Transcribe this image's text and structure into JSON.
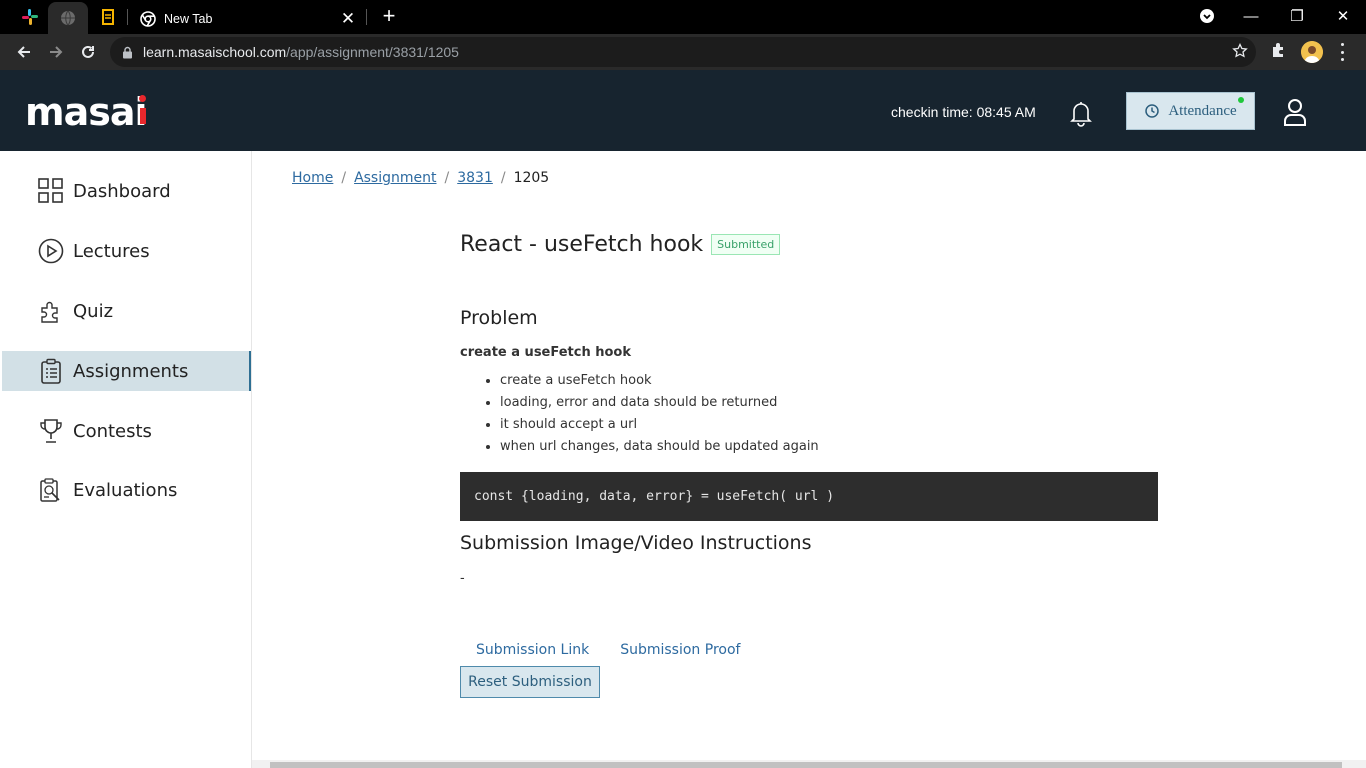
{
  "browser": {
    "tabs": [
      {
        "title": "New Tab"
      }
    ],
    "url_host": "learn.masaischool.com",
    "url_path": "/app/assignment/3831/1205",
    "window_controls": {
      "minimize": "—",
      "maximize": "❐",
      "close": "✕"
    }
  },
  "header": {
    "logo": "masai",
    "checkin": "checkin time: 08:45 AM",
    "attendance_label": "Attendance"
  },
  "sidebar": {
    "items": [
      {
        "label": "Dashboard",
        "icon": "grid-icon"
      },
      {
        "label": "Lectures",
        "icon": "play-circle-icon"
      },
      {
        "label": "Quiz",
        "icon": "puzzle-icon"
      },
      {
        "label": "Assignments",
        "icon": "clipboard-icon",
        "active": true
      },
      {
        "label": "Contests",
        "icon": "trophy-icon"
      },
      {
        "label": "Evaluations",
        "icon": "evaluation-icon"
      }
    ]
  },
  "breadcrumb": {
    "items": [
      "Home",
      "Assignment",
      "3831",
      "1205"
    ]
  },
  "assignment": {
    "title": "React - useFetch hook",
    "status": "Submitted",
    "problem_heading": "Problem",
    "problem_subheading": "create a useFetch hook",
    "bullets": [
      "create a useFetch hook",
      "loading, error and data should be returned",
      "it should accept a url",
      "when url changes, data should be updated again"
    ],
    "code": "const {loading, data, error} = useFetch( url )",
    "instructions_heading": "Submission Image/Video Instructions",
    "instructions_value": "-",
    "submission_tabs": [
      "Submission Link",
      "Submission Proof"
    ],
    "reset_label": "Reset Submission"
  },
  "colors": {
    "header_bg": "#17242f",
    "accent": "#2d6aa0",
    "status_green": "#38a169",
    "logo_red": "#e8272c"
  }
}
